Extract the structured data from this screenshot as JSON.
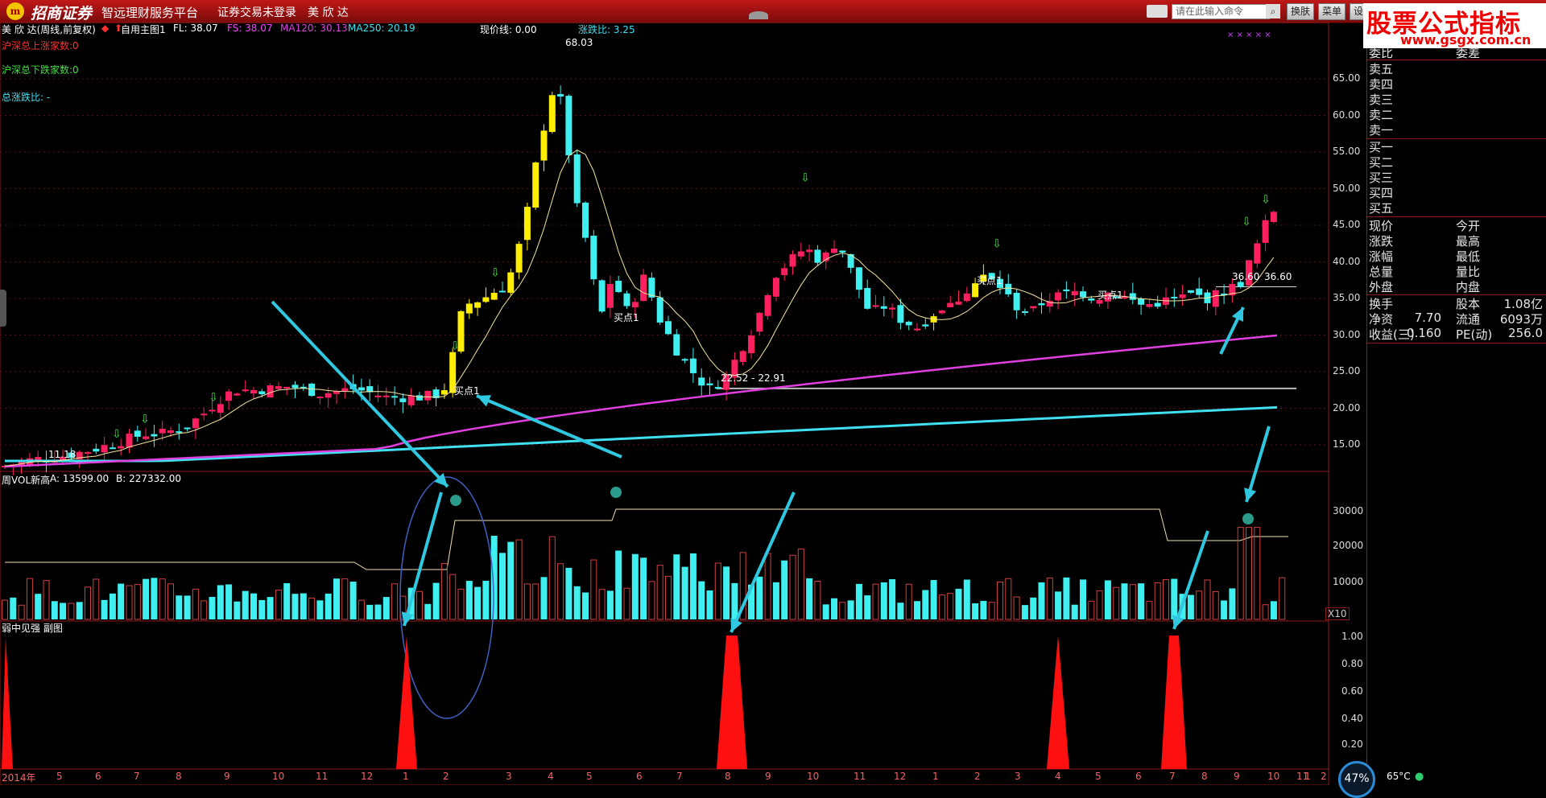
{
  "titlebar": {
    "logo": "m",
    "brand": "招商证券",
    "slogan": "智远理财服务平台",
    "trade_status": "证券交易未登录",
    "stock_name": "美 欣 达",
    "search_placeholder": "请在此输入命令",
    "buttons": [
      "换肤",
      "菜单",
      "设"
    ]
  },
  "watermark": {
    "line1": "股票公式指标网",
    "line2": "www.gsgx.com.cn"
  },
  "main_chart": {
    "stock_label": "美 欣 达(周线,前复权)",
    "template": "自用主图1",
    "fl": "FL: 38.07",
    "fs": "FS: 38.07",
    "ma120": "MA120: 30.13",
    "ma250": "MA250: 20.19",
    "current_line": "现价线: 0.00",
    "ratio": "涨跌比: 3.25",
    "stars": "× × × × ×",
    "left_stats": [
      "沪深总上涨家数:0",
      "沪深总下跌家数:0",
      "总涨跌比: -"
    ],
    "high_label": "68.03",
    "low_label": "11.18",
    "range_label": "22.52 - 22.91",
    "right_label1": "36.60",
    "right_label2": "36.60",
    "buy_label": "买点1",
    "colors": {
      "up": "#ff2060",
      "down": "#40f0f0",
      "yellow": "#ffee00",
      "ma120": "#e040e0",
      "ma250": "#40e0f0",
      "fl": "#f5e6a0"
    }
  },
  "y_axis_main": [
    "65.00",
    "60.00",
    "55.00",
    "50.00",
    "45.00",
    "40.00",
    "35.00",
    "30.00",
    "25.00",
    "20.00",
    "15.00"
  ],
  "vol_chart": {
    "title": "周VOL新高",
    "a": "A: 13599.00",
    "b": "B: 227332.00",
    "axis": [
      "30000",
      "20000",
      "10000"
    ],
    "scale": "X10"
  },
  "sub_chart": {
    "title": "弱中见强 副图",
    "axis": [
      "1.00",
      "0.80",
      "0.60",
      "0.40",
      "0.20"
    ]
  },
  "time_axis": [
    "2014年",
    "5",
    "6",
    "7",
    "8",
    "9",
    "10",
    "11",
    "12",
    "1",
    "2",
    "3",
    "4",
    "5",
    "6",
    "7",
    "8",
    "9",
    "10",
    "11",
    "12",
    "1",
    "2",
    "3",
    "4",
    "5",
    "6",
    "7",
    "8",
    "9",
    "10",
    "11",
    "1",
    "2"
  ],
  "quote_panel": {
    "ask_header": [
      "委比",
      "委差"
    ],
    "asks": [
      "卖五",
      "卖四",
      "卖三",
      "卖二",
      "卖一"
    ],
    "bids": [
      "买一",
      "买二",
      "买三",
      "买四",
      "买五"
    ],
    "fields_left": [
      "现价",
      "涨跌",
      "涨幅",
      "总量",
      "外盘"
    ],
    "fields_right": [
      "今开",
      "最高",
      "最低",
      "量比",
      "内盘"
    ],
    "stats": [
      {
        "l": "换手",
        "lv": "",
        "r": "股本",
        "rv": "1.08亿"
      },
      {
        "l": "净资",
        "lv": "7.70",
        "r": "流通",
        "rv": "6093万"
      },
      {
        "l": "收益(三)",
        "lv": "0.160",
        "r": "PE(动)",
        "rv": "256.0"
      }
    ]
  },
  "status": {
    "gauge": "47%",
    "temp": "65°C"
  }
}
